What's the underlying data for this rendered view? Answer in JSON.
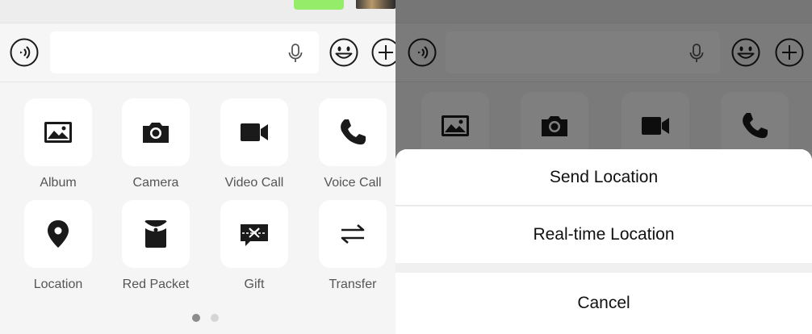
{
  "tray": {
    "items": [
      {
        "label": "Album",
        "icon": "image-icon"
      },
      {
        "label": "Camera",
        "icon": "camera-icon"
      },
      {
        "label": "Video Call",
        "icon": "video-camera-icon"
      },
      {
        "label": "Voice Call",
        "icon": "phone-icon"
      },
      {
        "label": "Location",
        "icon": "map-pin-icon"
      },
      {
        "label": "Red Packet",
        "icon": "red-packet-icon"
      },
      {
        "label": "Gift",
        "icon": "gift-icon"
      },
      {
        "label": "Transfer",
        "icon": "transfer-icon"
      }
    ],
    "page_indicator": {
      "current": 1,
      "total": 2
    }
  },
  "action_sheet": {
    "send_location": "Send Location",
    "realtime_location": "Real-time Location",
    "cancel": "Cancel"
  },
  "colors": {
    "tray_bg": "#f5f5f5",
    "tile_bg": "#ffffff",
    "icon": "#1a1a1a",
    "label": "#555555",
    "bubble": "#95ec69",
    "dot_active": "#8c8c8c",
    "dot_inactive": "#d5d5d5"
  }
}
